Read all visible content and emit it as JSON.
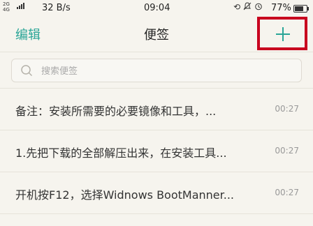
{
  "status_bar": {
    "network": "2G 4G 4G",
    "speed": "32 B/s",
    "time": "09:04",
    "battery": "77%",
    "battery_level": 0.77,
    "icons": [
      "rotate-lock-icon",
      "mute-icon",
      "alarm-icon"
    ]
  },
  "header": {
    "edit_label": "编辑",
    "title": "便签",
    "add_icon": "plus-icon",
    "accent_color": "#2aa597",
    "highlight_color": "#c8001e"
  },
  "search": {
    "placeholder": "搜索便签",
    "value": ""
  },
  "notes": [
    {
      "text": "备注：安装所需要的必要镜像和工具，...",
      "time": "00:27"
    },
    {
      "text": "1.先把下载的全部解压出来，在安装工具...",
      "time": "00:27"
    },
    {
      "text": "开机按F12，选择Widnows BootManner...",
      "time": "00:27"
    }
  ]
}
